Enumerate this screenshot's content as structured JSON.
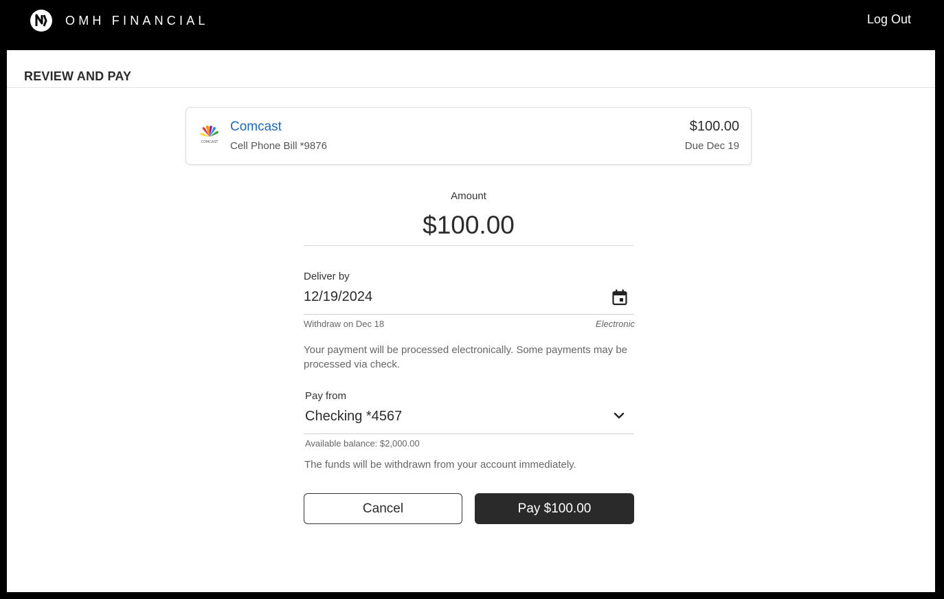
{
  "header": {
    "brand_name": "OMH FINANCIAL",
    "logout_label": "Log Out"
  },
  "page": {
    "title": "REVIEW AND PAY"
  },
  "bill": {
    "payee": "Comcast",
    "logo_text": "COMCAST",
    "description": "Cell Phone Bill *9876",
    "amount": "$100.00",
    "due": "Due Dec 19"
  },
  "amount": {
    "label": "Amount",
    "value": "$100.00"
  },
  "deliver": {
    "label": "Deliver by",
    "date": "12/19/2024",
    "withdraw_hint": "Withdraw on Dec 18",
    "method": "Electronic",
    "note": "Your payment will be processed electronically. Some payments may be processed via check."
  },
  "pay_from": {
    "label": "Pay from",
    "account": "Checking *4567",
    "balance": "Available balance: $2,000.00",
    "note": "The funds will be withdrawn from your account immediately."
  },
  "actions": {
    "cancel_label": "Cancel",
    "pay_label": "Pay $100.00"
  },
  "colors": {
    "accent_link": "#1d6ab5",
    "pay_button": "#2a2a2a",
    "topbar": "#000000"
  },
  "icons": {
    "brand": "brand-logo-icon",
    "payee": "comcast-peacock-icon",
    "date": "calendar-icon",
    "select": "chevron-down-icon"
  }
}
